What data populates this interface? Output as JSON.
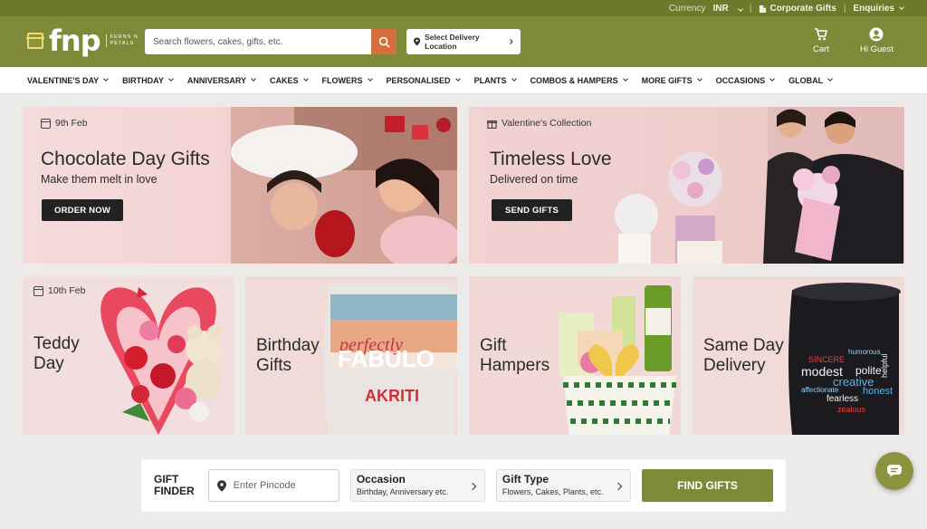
{
  "topbar": {
    "currency_label": "Currency",
    "currency_value": "INR",
    "corporate_gifts": "Corporate Gifts",
    "enquiries": "Enquiries"
  },
  "header": {
    "logo_text": "fnp",
    "logo_tagline": "FERNS N PETALS",
    "search_placeholder": "Search flowers, cakes, gifts, etc.",
    "delivery_location": "Select Delivery Location",
    "cart_label": "Cart",
    "account_label": "Hi Guest"
  },
  "nav": {
    "items": [
      "VALENTINE'S DAY",
      "BIRTHDAY",
      "ANNIVERSARY",
      "CAKES",
      "FLOWERS",
      "PERSONALISED",
      "PLANTS",
      "COMBOS & HAMPERS",
      "MORE GIFTS",
      "OCCASIONS",
      "GLOBAL"
    ]
  },
  "banners": {
    "chocolate": {
      "date": "9th Feb",
      "title": "Chocolate Day Gifts",
      "subtitle": "Make them melt in love",
      "cta": "ORDER NOW"
    },
    "valentine": {
      "chip": "Valentine's Collection",
      "title": "Timeless Love",
      "subtitle": "Delivered on time",
      "cta": "SEND GIFTS"
    }
  },
  "tiles": {
    "teddy": {
      "date": "10th Feb",
      "title_line1": "Teddy",
      "title_line2": "Day"
    },
    "birthday": {
      "title_line1": "Birthday",
      "title_line2": "Gifts",
      "pillow_text_1": "FABULO",
      "pillow_script": "perfectly",
      "pillow_name": "AKRITI"
    },
    "hampers": {
      "title_line1": "Gift",
      "title_line2": "Hampers"
    },
    "sameday": {
      "title_line1": "Same Day",
      "title_line2": "Delivery",
      "mug_words": [
        "SINCERE",
        "humorous",
        "modest",
        "polite",
        "creative",
        "affectionate",
        "fearless",
        "honest",
        "zealous",
        "helpful"
      ]
    }
  },
  "finder": {
    "label_line1": "GIFT",
    "label_line2": "FINDER",
    "pincode_placeholder": "Enter Pincode",
    "occasion_title": "Occasion",
    "occasion_sub": "Birthday, Anniversary etc.",
    "gifttype_title": "Gift Type",
    "gifttype_sub": "Flowers, Cakes, Plants, etc.",
    "cta": "FIND GIFTS"
  },
  "colors": {
    "brand_olive": "#7f8a38",
    "topbar": "#6d7a2c",
    "search_orange": "#d66e3d",
    "banner_pink": "#f1d3d2"
  }
}
